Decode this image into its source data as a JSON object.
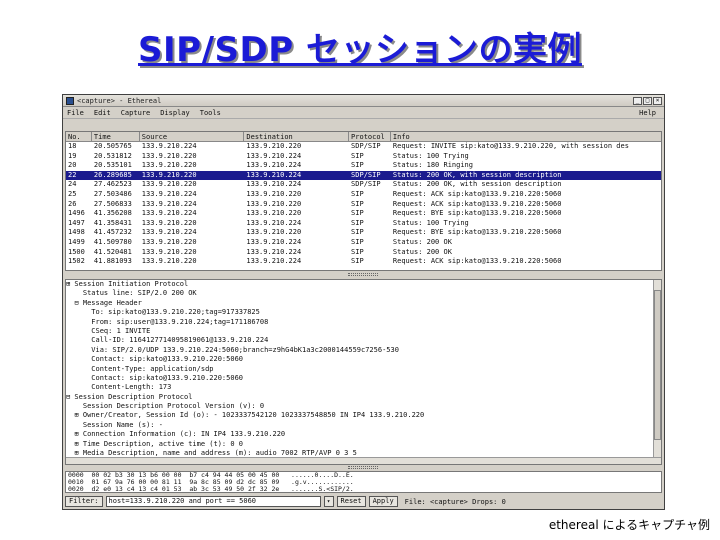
{
  "slide": {
    "title": "SIP/SDP セッションの実例",
    "caption": "ethereal によるキャプチャ例"
  },
  "window": {
    "title": "<capture> - Ethereal",
    "controls": [
      "_",
      "□",
      "×"
    ]
  },
  "menu": {
    "items": [
      "File",
      "Edit",
      "Capture",
      "Display",
      "Tools"
    ],
    "help": "Help"
  },
  "packet_list": {
    "columns": [
      "No.",
      "Time",
      "Source",
      "Destination",
      "Protocol",
      "Info"
    ],
    "rows": [
      {
        "no": "18",
        "time": "20.505765",
        "src": "133.9.210.224",
        "dst": "133.9.210.220",
        "proto": "SDP/SIP",
        "info": "Request: INVITE sip:kato@133.9.210.220, with session des"
      },
      {
        "no": "19",
        "time": "20.531812",
        "src": "133.9.210.220",
        "dst": "133.9.210.224",
        "proto": "SIP",
        "info": "Status: 100 Trying"
      },
      {
        "no": "20",
        "time": "20.535101",
        "src": "133.9.210.220",
        "dst": "133.9.210.224",
        "proto": "SIP",
        "info": "Status: 180 Ringing"
      },
      {
        "no": "22",
        "time": "26.289685",
        "src": "133.9.210.220",
        "dst": "133.9.210.224",
        "proto": "SDP/SIP",
        "info": "Status: 200 OK, with session description"
      },
      {
        "no": "24",
        "time": "27.462523",
        "src": "133.9.210.220",
        "dst": "133.9.210.224",
        "proto": "SDP/SIP",
        "info": "Status: 200 OK, with session description"
      },
      {
        "no": "25",
        "time": "27.503486",
        "src": "133.9.210.224",
        "dst": "133.9.210.220",
        "proto": "SIP",
        "info": "Request: ACK sip:kato@133.9.210.220:5060"
      },
      {
        "no": "26",
        "time": "27.506833",
        "src": "133.9.210.224",
        "dst": "133.9.210.220",
        "proto": "SIP",
        "info": "Request: ACK sip:kato@133.9.210.220:5060"
      },
      {
        "no": "1496",
        "time": "41.356208",
        "src": "133.9.210.224",
        "dst": "133.9.210.220",
        "proto": "SIP",
        "info": "Request: BYE sip:kato@133.9.210.220:5060"
      },
      {
        "no": "1497",
        "time": "41.358431",
        "src": "133.9.210.220",
        "dst": "133.9.210.224",
        "proto": "SIP",
        "info": "Status: 100 Trying"
      },
      {
        "no": "1498",
        "time": "41.457232",
        "src": "133.9.210.224",
        "dst": "133.9.210.220",
        "proto": "SIP",
        "info": "Request: BYE sip:kato@133.9.210.220:5060"
      },
      {
        "no": "1499",
        "time": "41.509780",
        "src": "133.9.210.220",
        "dst": "133.9.210.224",
        "proto": "SIP",
        "info": "Status: 200 OK"
      },
      {
        "no": "1500",
        "time": "41.520481",
        "src": "133.9.210.220",
        "dst": "133.9.210.224",
        "proto": "SIP",
        "info": "Status: 200 OK"
      },
      {
        "no": "1502",
        "time": "41.881093",
        "src": "133.9.210.220",
        "dst": "133.9.210.224",
        "proto": "SIP",
        "info": "Request: ACK sip:kato@133.9.210.220:5060"
      }
    ],
    "selected_index": 3
  },
  "detail_tree": {
    "lines": [
      "⊞ Session Initiation Protocol",
      "    Status line: SIP/2.0 200 OK",
      "  ⊟ Message Header",
      "      To: sip:kato@133.9.210.220;tag=917337825",
      "      From: sip:user@133.9.210.224;tag=171186708",
      "      CSeq: 1 INVITE",
      "      Call-ID: 1164127714095819061@133.9.210.224",
      "      Via: SIP/2.0/UDP 133.9.210.224:5060;branch=z9hG4bK1a3c2000144559c7256-530",
      "      Contact: sip:kato@133.9.210.220:5060",
      "      Content-Type: application/sdp",
      "      Contact: sip:kato@133.9.210.220:5060",
      "      Content-Length: 173",
      "⊟ Session Description Protocol",
      "    Session Description Protocol Version (v): 0",
      "  ⊞ Owner/Creator, Session Id (o): - 1023337542120 1023337548850 IN IP4 133.9.210.220",
      "    Session Name (s): -",
      "  ⊞ Connection Information (c): IN IP4 133.9.210.220",
      "  ⊞ Time Description, active time (t): 0 0",
      "  ⊞ Media Description, name and address (m): audio 7002 RTP/AVP 0 3 5"
    ]
  },
  "hex": {
    "lines": [
      "0000  00 02 b3 30 13 b6 00 00  b7 c4 94 44 05 00 45 00   ......0....D..E.",
      "0010  01 67 9a 76 00 00 81 11  9a 8c 85 09 d2 dc 85 09   .g.v............",
      "0020  d2 e0 13 c4 13 c4 01 53  ab 3c 53 49 50 2f 32 2e   .......S.<SIP/2."
    ]
  },
  "status": {
    "filter_label": "Filter:",
    "filter_value": "host=133.9.210.220 and port == 5060",
    "reset_label": "Reset",
    "apply_label": "Apply",
    "file_info": "File: <capture>  Drops: 0"
  }
}
